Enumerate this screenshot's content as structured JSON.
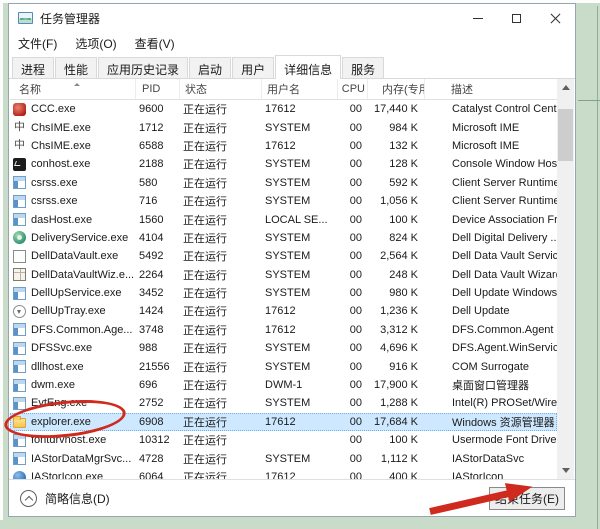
{
  "window": {
    "title": "任务管理器"
  },
  "menu": {
    "items": [
      "文件(F)",
      "选项(O)",
      "查看(V)"
    ]
  },
  "tabs": {
    "selected_index": 5,
    "items": [
      {
        "label": "进程"
      },
      {
        "label": "性能"
      },
      {
        "label": "应用历史记录"
      },
      {
        "label": "启动"
      },
      {
        "label": "用户"
      },
      {
        "label": "详细信息"
      },
      {
        "label": "服务"
      }
    ]
  },
  "table": {
    "columns": [
      {
        "id": "name",
        "label": "名称"
      },
      {
        "id": "pid",
        "label": "PID"
      },
      {
        "id": "status",
        "label": "状态"
      },
      {
        "id": "user",
        "label": "用户名"
      },
      {
        "id": "cpu",
        "label": "CPU"
      },
      {
        "id": "mem",
        "label": "内存(专用..."
      },
      {
        "id": "desc",
        "label": "描述"
      }
    ],
    "sort": {
      "column": "name",
      "direction": "ascending"
    },
    "rows": [
      {
        "icon": "ccc",
        "name": "CCC.exe",
        "pid": "9600",
        "status": "正在运行",
        "user": "17612",
        "cpu": "00",
        "mem": "17,440 K",
        "desc": "Catalyst Control Cent..."
      },
      {
        "icon": "ime",
        "name": "ChsIME.exe",
        "pid": "1712",
        "status": "正在运行",
        "user": "SYSTEM",
        "cpu": "00",
        "mem": "984 K",
        "desc": "Microsoft IME"
      },
      {
        "icon": "ime",
        "name": "ChsIME.exe",
        "pid": "6588",
        "status": "正在运行",
        "user": "17612",
        "cpu": "00",
        "mem": "132 K",
        "desc": "Microsoft IME"
      },
      {
        "icon": "console",
        "name": "conhost.exe",
        "pid": "2188",
        "status": "正在运行",
        "user": "SYSTEM",
        "cpu": "00",
        "mem": "128 K",
        "desc": "Console Window Host"
      },
      {
        "icon": "default",
        "name": "csrss.exe",
        "pid": "580",
        "status": "正在运行",
        "user": "SYSTEM",
        "cpu": "00",
        "mem": "592 K",
        "desc": "Client Server Runtime ..."
      },
      {
        "icon": "default",
        "name": "csrss.exe",
        "pid": "716",
        "status": "正在运行",
        "user": "SYSTEM",
        "cpu": "00",
        "mem": "1,056 K",
        "desc": "Client Server Runtime ..."
      },
      {
        "icon": "default",
        "name": "dasHost.exe",
        "pid": "1560",
        "status": "正在运行",
        "user": "LOCAL SE...",
        "cpu": "00",
        "mem": "100 K",
        "desc": "Device Association Fr..."
      },
      {
        "icon": "gear",
        "name": "DeliveryService.exe",
        "pid": "4104",
        "status": "正在运行",
        "user": "SYSTEM",
        "cpu": "00",
        "mem": "824 K",
        "desc": "Dell Digital Delivery ..."
      },
      {
        "icon": "window",
        "name": "DellDataVault.exe",
        "pid": "5492",
        "status": "正在运行",
        "user": "SYSTEM",
        "cpu": "00",
        "mem": "2,564 K",
        "desc": "Dell Data Vault Service"
      },
      {
        "icon": "wizard",
        "name": "DellDataVaultWiz.e...",
        "pid": "2264",
        "status": "正在运行",
        "user": "SYSTEM",
        "cpu": "00",
        "mem": "248 K",
        "desc": "Dell Data Vault Wizard"
      },
      {
        "icon": "default",
        "name": "DellUpService.exe",
        "pid": "3452",
        "status": "正在运行",
        "user": "SYSTEM",
        "cpu": "00",
        "mem": "980 K",
        "desc": "Dell Update Windows..."
      },
      {
        "icon": "tray",
        "name": "DellUpTray.exe",
        "pid": "1424",
        "status": "正在运行",
        "user": "17612",
        "cpu": "00",
        "mem": "1,236 K",
        "desc": "Dell Update"
      },
      {
        "icon": "default",
        "name": "DFS.Common.Age...",
        "pid": "3748",
        "status": "正在运行",
        "user": "17612",
        "cpu": "00",
        "mem": "3,312 K",
        "desc": "DFS.Common.Agent"
      },
      {
        "icon": "default",
        "name": "DFSSvc.exe",
        "pid": "988",
        "status": "正在运行",
        "user": "SYSTEM",
        "cpu": "00",
        "mem": "4,696 K",
        "desc": "DFS.Agent.WinService"
      },
      {
        "icon": "default",
        "name": "dllhost.exe",
        "pid": "21556",
        "status": "正在运行",
        "user": "SYSTEM",
        "cpu": "00",
        "mem": "916 K",
        "desc": "COM Surrogate"
      },
      {
        "icon": "default",
        "name": "dwm.exe",
        "pid": "696",
        "status": "正在运行",
        "user": "DWM-1",
        "cpu": "00",
        "mem": "17,900 K",
        "desc": "桌面窗口管理器"
      },
      {
        "icon": "default",
        "name": "EvtEng.exe",
        "pid": "2752",
        "status": "正在运行",
        "user": "SYSTEM",
        "cpu": "00",
        "mem": "1,288 K",
        "desc": "Intel(R) PROSet/Wirel..."
      },
      {
        "icon": "folder",
        "name": "explorer.exe",
        "pid": "6908",
        "status": "正在运行",
        "user": "17612",
        "cpu": "00",
        "mem": "17,684 K",
        "desc": "Windows 资源管理器",
        "selected": true
      },
      {
        "icon": "default",
        "name": "fontdrvhost.exe",
        "pid": "10312",
        "status": "正在运行",
        "user": "",
        "cpu": "00",
        "mem": "100 K",
        "desc": "Usermode Font Drive..."
      },
      {
        "icon": "default",
        "name": "IAStorDataMgrSvc...",
        "pid": "4728",
        "status": "正在运行",
        "user": "SYSTEM",
        "cpu": "00",
        "mem": "1,112 K",
        "desc": "IAStorDataSvc"
      },
      {
        "icon": "storage",
        "name": "IAStorIcon.exe",
        "pid": "6064",
        "status": "正在运行",
        "user": "17612",
        "cpu": "00",
        "mem": "400 K",
        "desc": "IAStorIcon"
      }
    ]
  },
  "footer": {
    "details_toggle_label": "简略信息(D)",
    "end_task_label": "结束任务(E)"
  },
  "annotations": {
    "color": "#d0291d"
  }
}
